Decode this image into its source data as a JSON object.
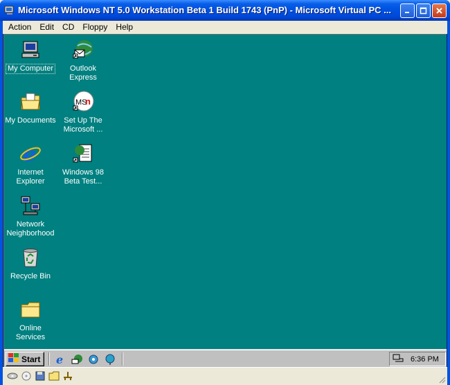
{
  "window": {
    "title": "Microsoft Windows NT 5.0 Workstation Beta 1 Build 1743 (PnP) - Microsoft Virtual PC ...",
    "colors": {
      "titlebar": "#0054e3",
      "desktop": "#008080",
      "taskbar": "#c0c0c0"
    }
  },
  "menubar": {
    "items": [
      "Action",
      "Edit",
      "CD",
      "Floppy",
      "Help"
    ]
  },
  "desktop": {
    "icons": [
      {
        "label": "My Computer",
        "icon": "my-computer-icon"
      },
      {
        "label": "Outlook Express",
        "icon": "outlook-express-icon"
      },
      {
        "label": "My Documents",
        "icon": "folder-documents-icon"
      },
      {
        "label": "Set Up The Microsoft ...",
        "icon": "msn-icon"
      },
      {
        "label": "Internet Explorer",
        "icon": "internet-explorer-icon"
      },
      {
        "label": "Windows 98 Beta Test...",
        "icon": "document-globe-icon"
      },
      {
        "label": "Network Neighborhood",
        "icon": "network-icon"
      },
      {
        "label": "Recycle Bin",
        "icon": "recycle-bin-icon"
      },
      {
        "label": "Online Services",
        "icon": "folder-icon"
      }
    ]
  },
  "taskbar": {
    "start_label": "Start",
    "quick_launch": [
      "internet-explorer-icon",
      "outlook-express-icon",
      "channels-icon",
      "view-channels-icon"
    ],
    "clock": "6:36 PM"
  },
  "statusbar": {
    "icons": [
      "cd-icon",
      "floppy-disk-icon",
      "save-icon",
      "folder-icon",
      "network-adapter-icon"
    ]
  }
}
